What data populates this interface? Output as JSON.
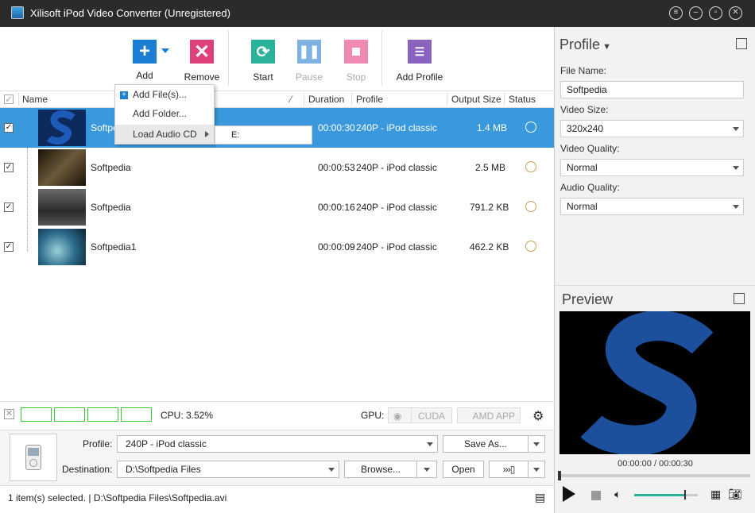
{
  "window": {
    "title": "Xilisoft iPod Video Converter (Unregistered)",
    "controls": [
      "menu-icon",
      "minimize-icon",
      "restore-icon",
      "close-icon"
    ]
  },
  "toolbar": {
    "add": {
      "label": "Add",
      "icon": "plus-icon",
      "color": "#1a7fd4"
    },
    "remove": {
      "label": "Remove",
      "icon": "x-icon",
      "color": "#e0407a"
    },
    "start": {
      "label": "Start",
      "icon": "refresh-icon",
      "color": "#2bb39a"
    },
    "pause": {
      "label": "Pause",
      "icon": "pause-icon",
      "color": "#7fb2e0"
    },
    "stop": {
      "label": "Stop",
      "icon": "stop-icon",
      "color": "#f08ab4"
    },
    "add_profile": {
      "label": "Add Profile",
      "icon": "document-icon",
      "color": "#8a63c0"
    }
  },
  "add_menu": {
    "items": [
      "Add File(s)...",
      "Add Folder...",
      "Load Audio CD"
    ],
    "submenu_item": "E:"
  },
  "list": {
    "headers": {
      "name": "Name",
      "duration": "Duration",
      "profile": "Profile",
      "output_size": "Output Size",
      "status": "Status"
    },
    "rows": [
      {
        "name": "Softpedia",
        "duration": "00:00:30",
        "profile": "240P - iPod classic",
        "size": "1.4 MB",
        "checked": true,
        "selected": true
      },
      {
        "name": "Softpedia",
        "duration": "00:00:53",
        "profile": "240P - iPod classic",
        "size": "2.5 MB",
        "checked": true,
        "selected": false
      },
      {
        "name": "Softpedia",
        "duration": "00:00:16",
        "profile": "240P - iPod classic",
        "size": "791.2 KB",
        "checked": true,
        "selected": false
      },
      {
        "name": "Softpedia1",
        "duration": "00:00:09",
        "profile": "240P - iPod classic",
        "size": "462.2 KB",
        "checked": true,
        "selected": false
      }
    ]
  },
  "cpu": {
    "label": "CPU: 3.52%",
    "gpu_label": "GPU:",
    "cuda": "CUDA",
    "amd": "AMD APP"
  },
  "form": {
    "profile_label": "Profile:",
    "profile_value": "240P - iPod classic",
    "save_as": "Save As...",
    "destination_label": "Destination:",
    "destination_value": "D:\\Softpedia Files",
    "browse": "Browse...",
    "open": "Open"
  },
  "status": {
    "text": "1 item(s) selected. | D:\\Softpedia Files\\Softpedia.avi"
  },
  "profile_panel": {
    "title": "Profile",
    "file_name_label": "File Name:",
    "file_name_value": "Softpedia",
    "video_size_label": "Video Size:",
    "video_size_value": "320x240",
    "video_quality_label": "Video Quality:",
    "video_quality_value": "Normal",
    "audio_quality_label": "Audio Quality:",
    "audio_quality_value": "Normal"
  },
  "preview": {
    "title": "Preview",
    "time": "00:00:00 / 00:00:30",
    "volume": 0.8
  }
}
